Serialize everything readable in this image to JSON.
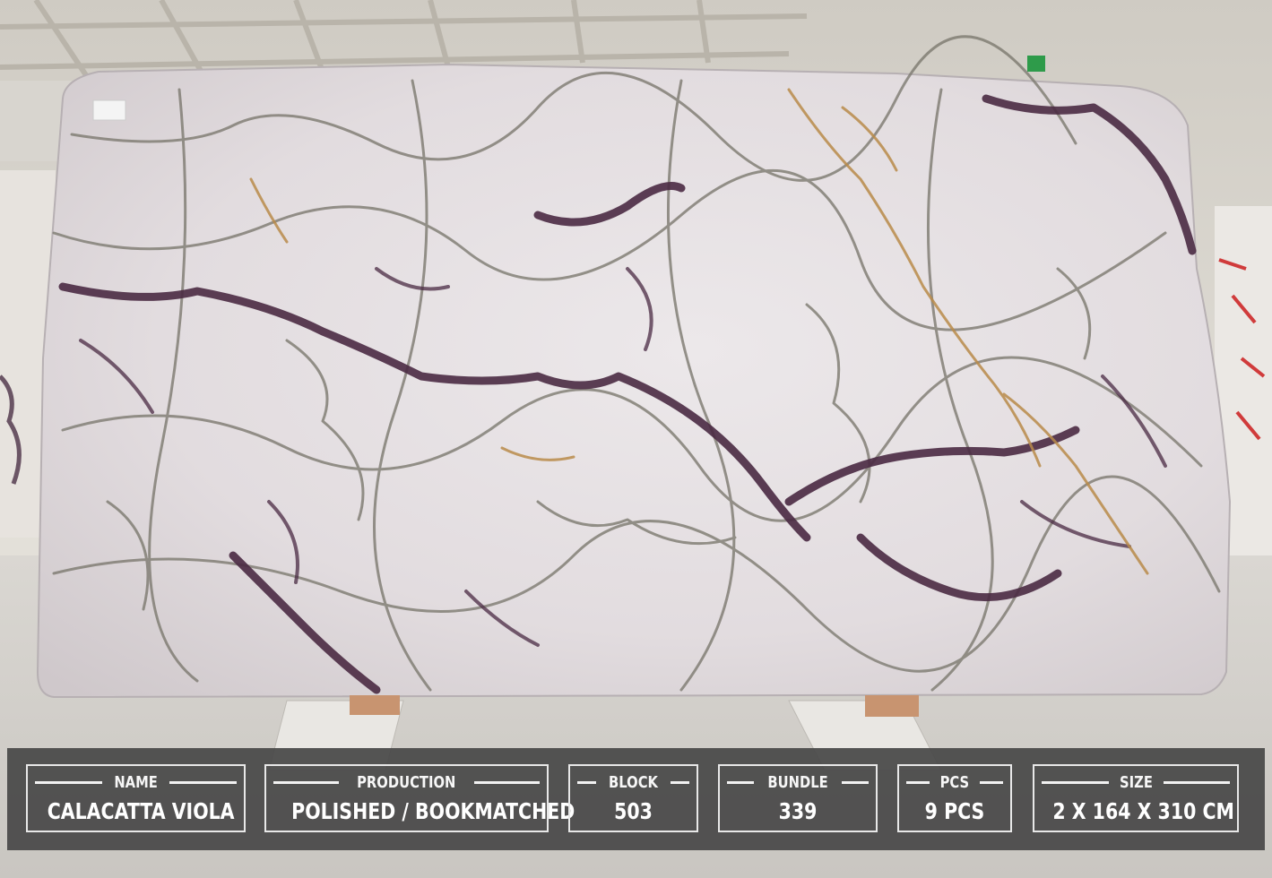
{
  "image": {
    "subject": "marble-slab",
    "colors": {
      "stone_base": "#e6e1e4",
      "vein_purple": "#4a2a43",
      "vein_gold": "#b98b4a",
      "vein_grey": "#7d7a70",
      "floor": "#d2cfca",
      "overlay": "#484848"
    }
  },
  "info": {
    "name": {
      "label": "NAME",
      "value": "CALACATTA VIOLA"
    },
    "production": {
      "label": "PRODUCTION",
      "value": "POLISHED / BOOKMATCHED"
    },
    "block": {
      "label": "BLOCK",
      "value": "503"
    },
    "bundle": {
      "label": "BUNDLE",
      "value": "339"
    },
    "pcs": {
      "label": "PCS",
      "value": "9 PCS"
    },
    "size": {
      "label": "SIZE",
      "value": "2 X 164 X 310 CM"
    }
  }
}
